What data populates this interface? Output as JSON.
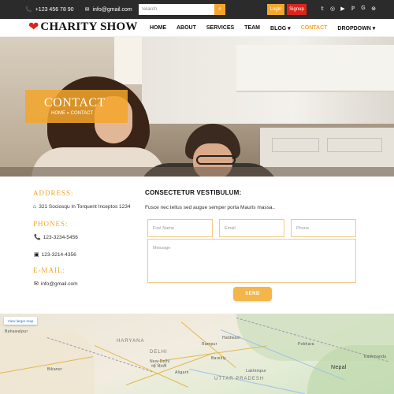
{
  "topbar": {
    "phone": "+123 456 78 90",
    "email": "info@gmail.com",
    "search_placeholder": "Search",
    "login_label": "Login",
    "signup_label": "Signup",
    "social_icons": [
      "twitter-icon",
      "instagram-icon",
      "youtube-icon",
      "pinterest-icon",
      "google-icon",
      "dribbble-icon"
    ]
  },
  "brand": {
    "name": "CHARITY SHOW"
  },
  "nav": {
    "items": [
      "HOME",
      "ABOUT",
      "SERVICES",
      "TEAM",
      "BLOG ▾",
      "CONTACT",
      "DROPDOWN ▾"
    ],
    "active": "CONTACT"
  },
  "hero": {
    "title": "CONTACT",
    "breadcrumb": "HOME » CONTACT"
  },
  "contact_info": {
    "address_label": "ADDRESS:",
    "address": "321 Sociosqu In Torquent Inceptos 1234",
    "phones_label": "PHONES:",
    "phone1": "123-3234-5456",
    "phone2": "123-3214-4356",
    "email_label": "E-MAIL:",
    "email": "info@gmail.com"
  },
  "form": {
    "heading": "CONSECTETUR VESTIBULUM:",
    "description": "Fusce nec tellus sed augue semper porta Mauris massa..",
    "first_name_placeholder": "First Name",
    "email_placeholder": "Email",
    "phone_placeholder": "Phone",
    "message_placeholder": "Message",
    "send_label": "SEND"
  },
  "map": {
    "view_larger": "View larger map",
    "labels": {
      "haryana": "HARYANA",
      "delhi": "DELHI",
      "new_delhi": "New Delhi",
      "new_delhi_hindi": "नई दिल्ली",
      "uttar_pradesh": "UTTAR PRADESH",
      "nepal": "Nepal",
      "kathmandu": "Kathmandu",
      "bikaner": "Bikaner",
      "bareilly": "Bareilly",
      "rampur": "Rampur",
      "haldwani": "Haldwani",
      "aligarh": "Aligarh",
      "lakhimpur": "Lakhimpur",
      "pokhara": "Pokhara",
      "bahawalpur": "Bahawalpur"
    }
  },
  "colors": {
    "accent": "#f4a62a",
    "danger": "#d9261c",
    "topbar": "#2b2b2b"
  }
}
